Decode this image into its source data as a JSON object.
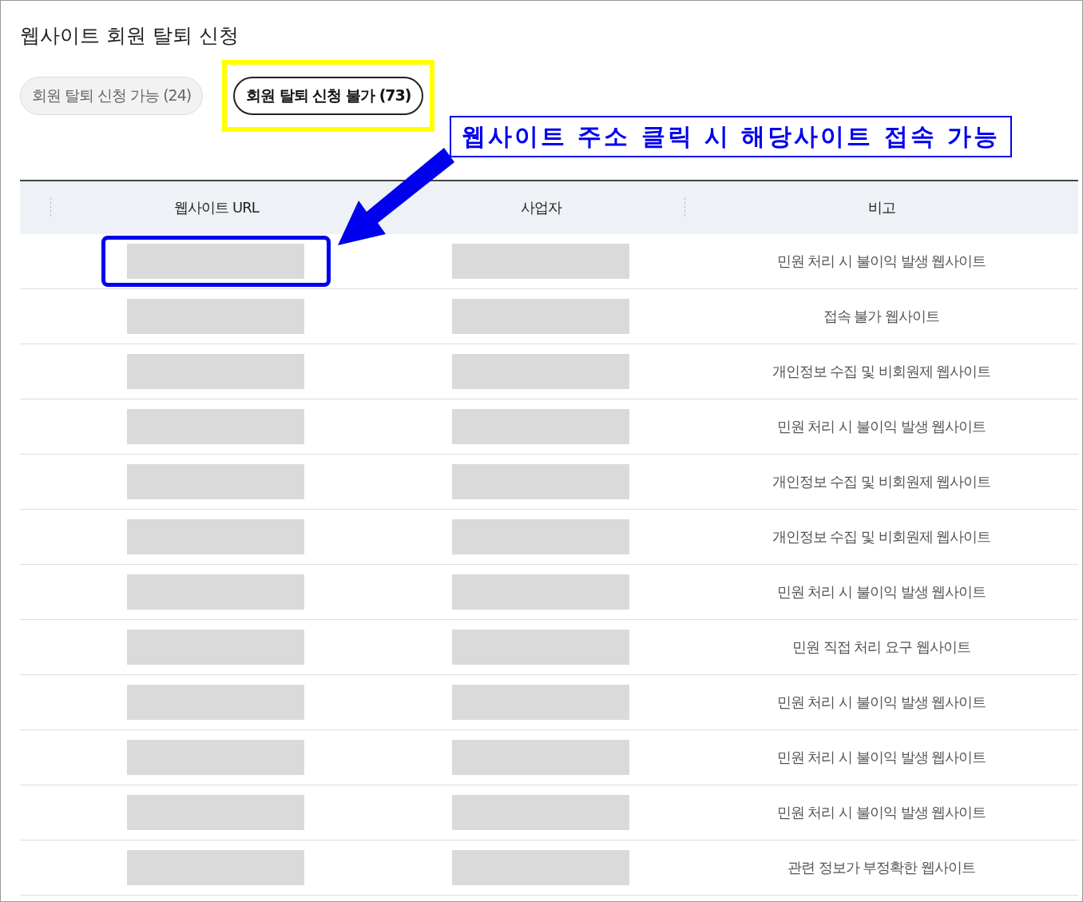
{
  "page": {
    "title": "웹사이트 회원 탈퇴 신청"
  },
  "tabs": [
    {
      "label": "회원 탈퇴 신청 가능 (24)",
      "selected": false,
      "highlighted": false
    },
    {
      "label": "회원 탈퇴 신청 불가 (73)",
      "selected": true,
      "highlighted": true
    }
  ],
  "callout": {
    "text": "웹사이트 주소 클릭 시 해당사이트 접속 가능"
  },
  "table": {
    "columns": [
      "웹사이트 URL",
      "사업자",
      "비고"
    ],
    "rows": [
      {
        "note": "민원 처리 시 불이익 발생 웹사이트",
        "highlighted": true
      },
      {
        "note": "접속 불가 웹사이트",
        "highlighted": false
      },
      {
        "note": "개인정보 수집 및 비회원제 웹사이트",
        "highlighted": false
      },
      {
        "note": "민원 처리 시 불이익 발생 웹사이트",
        "highlighted": false
      },
      {
        "note": "개인정보 수집 및 비회원제 웹사이트",
        "highlighted": false
      },
      {
        "note": "개인정보 수집 및 비회원제 웹사이트",
        "highlighted": false
      },
      {
        "note": "민원 처리 시 불이익 발생 웹사이트",
        "highlighted": false
      },
      {
        "note": "민원 직접 처리 요구 웹사이트",
        "highlighted": false
      },
      {
        "note": "민원 처리 시 불이익 발생 웹사이트",
        "highlighted": false
      },
      {
        "note": "민원 처리 시 불이익 발생 웹사이트",
        "highlighted": false
      },
      {
        "note": "민원 처리 시 불이익 발생 웹사이트",
        "highlighted": false
      },
      {
        "note": "관련 정보가 부정확한 웹사이트",
        "highlighted": false
      }
    ]
  }
}
